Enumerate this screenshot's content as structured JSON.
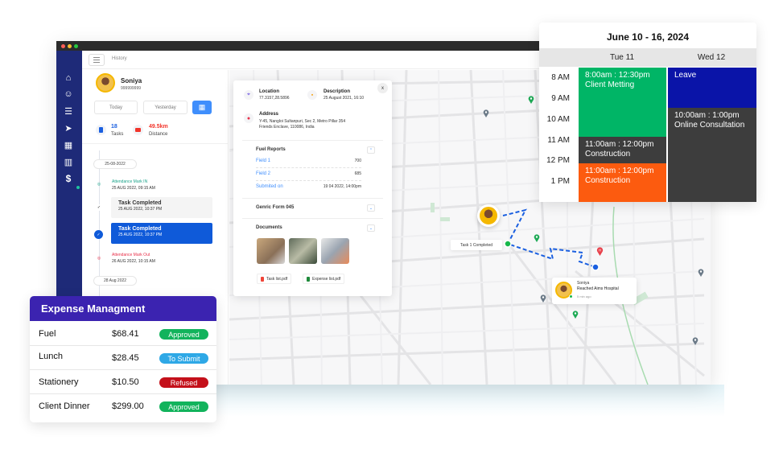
{
  "app": {
    "breadcrumb": "History"
  },
  "sidebar": {
    "items": [
      {
        "icon": "home-icon",
        "glyph": "⌂"
      },
      {
        "icon": "team-icon",
        "glyph": "☺"
      },
      {
        "icon": "checklist-icon",
        "glyph": "☰"
      },
      {
        "icon": "navigation-icon",
        "glyph": "➤"
      },
      {
        "icon": "calendar-icon",
        "glyph": "▦"
      },
      {
        "icon": "bar-chart-icon",
        "glyph": "▥"
      },
      {
        "icon": "dollar-icon",
        "glyph": "$"
      }
    ],
    "active_index": 6
  },
  "profile": {
    "name": "Soniya",
    "phone": "999999999"
  },
  "filters": {
    "today": "Today",
    "yesterday": "Yesterday",
    "calendar_icon": "▦"
  },
  "stats": {
    "tasks_value": "18",
    "tasks_label": "Tasks",
    "distance_value": "49.5km",
    "distance_label": "Distance"
  },
  "timeline": {
    "date1": "25-08-2022",
    "mark_in_title": "Attendance Mark IN",
    "mark_in_time": "25 AUG 2022, 09:15 AM",
    "task1_title": "Task Completed",
    "task1_time": "25 AUG 2022, 10:37 PM",
    "task2_title": "Task Completed",
    "task2_time": "25 AUG 2022, 10:37 PM",
    "mark_out_title": "Attendance Mark Out",
    "mark_out_time": "26 AUG 2022, 10:15 AM",
    "date2": "28 Aug 2022"
  },
  "detail": {
    "close": "x",
    "location_label": "Location",
    "location_value": "77.3157,28.5896",
    "description_label": "Description",
    "description_value": "25 August 2021, 16:10",
    "address_label": "Address",
    "address_line1": "Y-45, Nangloi Sultanpuri, Sec 2, Metro Pillar 354",
    "address_line2": "Friends Enclave, 110086, India",
    "fuel_title": "Fuel Reports",
    "fields": [
      {
        "key": "Field 1",
        "value": "700"
      },
      {
        "key": "Field 2",
        "value": "685"
      },
      {
        "key": "Submited on",
        "value": "19 04 2022, 14:00pm"
      }
    ],
    "generic_form": "Genric Form 045",
    "documents": "Documents",
    "files": [
      "Task list.pdf",
      "Expense list.pdf"
    ]
  },
  "map": {
    "task_tag": "Task 1 Completed",
    "notification": {
      "name": "Soniya",
      "message": "Reached Aims Hospital",
      "time": "5 min ago"
    }
  },
  "calendar": {
    "title": "June 10 - 16, 2024",
    "days": [
      "Tue 11",
      "Wed 12"
    ],
    "hours": [
      "8 AM",
      "9 AM",
      "10 AM",
      "11 AM",
      "12 PM",
      "1 PM"
    ],
    "events": [
      {
        "time": "8:00am : 12:30pm",
        "title": "Client Metting",
        "color": "#00b566"
      },
      {
        "time": "",
        "title": "Leave",
        "color": "#0a14a8"
      },
      {
        "time": "10:00am : 1:00pm",
        "title": "Online Consultation",
        "color": "#3d3d3d"
      },
      {
        "time": "11:00am : 12:00pm",
        "title": "Construction",
        "color": "#3d3d3d"
      },
      {
        "time": "11:00am : 12:00pm",
        "title": "Construction",
        "color": "#fc5b0f"
      }
    ]
  },
  "expense": {
    "title": "Expense  Managment",
    "rows": [
      {
        "name": "Fuel",
        "amount": "$68.41",
        "status": "Approved",
        "color": "#12b35c"
      },
      {
        "name": "Lunch",
        "amount": "$28.45",
        "status": "To Submit",
        "color": "#2ea8e6"
      },
      {
        "name": "Stationery",
        "amount": "$10.50",
        "status": "Refused",
        "color": "#c4101a"
      },
      {
        "name": "Client Dinner",
        "amount": "$299.00",
        "status": "Approved",
        "color": "#12b35c"
      }
    ]
  }
}
